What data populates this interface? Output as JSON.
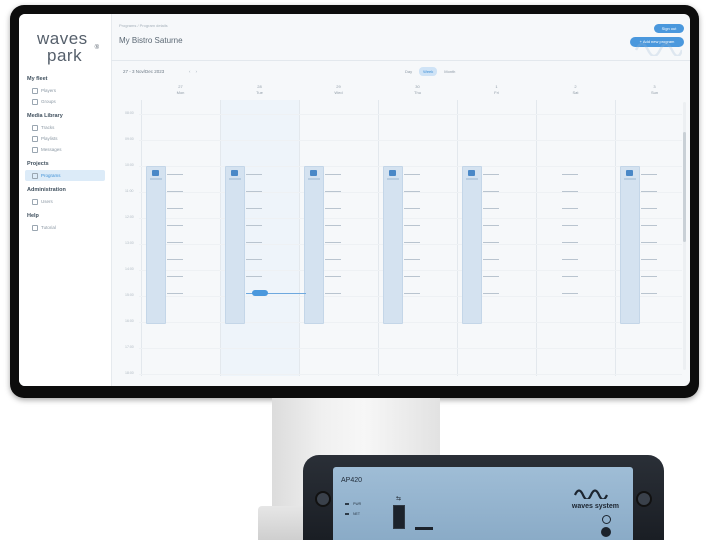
{
  "sidebar": {
    "logo_line1": "waves",
    "logo_line2": "park",
    "logo_reg": "®",
    "sections": [
      {
        "title": "My fleet",
        "items": [
          {
            "label": "Players",
            "icon": "player-icon"
          },
          {
            "label": "Groups",
            "icon": "group-icon"
          }
        ]
      },
      {
        "title": "Media Library",
        "items": [
          {
            "label": "Tracks",
            "icon": "track-icon"
          },
          {
            "label": "Playlists",
            "icon": "playlist-icon"
          },
          {
            "label": "Messages",
            "icon": "message-icon"
          }
        ]
      },
      {
        "title": "Projects",
        "items": [
          {
            "label": "Programs",
            "icon": "calendar-icon",
            "active": true
          }
        ]
      },
      {
        "title": "Administration",
        "items": [
          {
            "label": "Users",
            "icon": "user-icon"
          }
        ]
      },
      {
        "title": "Help",
        "items": [
          {
            "label": "Tutorial",
            "icon": "help-icon"
          }
        ]
      }
    ]
  },
  "header": {
    "breadcrumb": "Programs / Program details",
    "title": "My Bistro Saturne",
    "signout_label": "Sign out",
    "add_label": "+ Add new program"
  },
  "toolbar": {
    "date_range": "27 - 3 Nov/Dec 2023",
    "prev_icon": "chevron-left-icon",
    "next_icon": "chevron-right-icon",
    "views": [
      {
        "label": "Day"
      },
      {
        "label": "Week",
        "active": true
      },
      {
        "label": "Month"
      }
    ]
  },
  "calendar": {
    "days": [
      {
        "num": "27",
        "name": "Mon"
      },
      {
        "num": "28",
        "name": "Tue"
      },
      {
        "num": "29",
        "name": "Wed"
      },
      {
        "num": "30",
        "name": "Thu"
      },
      {
        "num": "1",
        "name": "Fri"
      },
      {
        "num": "2",
        "name": "Sat"
      },
      {
        "num": "3",
        "name": "Sun"
      }
    ],
    "times": [
      "08:00",
      "09:00",
      "10:00",
      "11:00",
      "12:00",
      "13:00",
      "14:00",
      "15:00",
      "16:00",
      "17:00",
      "18:00"
    ],
    "event_days": [
      0,
      1,
      2,
      3,
      4,
      6
    ],
    "highlight_day": 1,
    "now_label": "14:52"
  },
  "device": {
    "model": "AP420",
    "brand": "waves system",
    "led_labels": [
      "PWR",
      "NET"
    ]
  },
  "colors": {
    "accent": "#4a98dd",
    "event_fill": "#d4e2f0",
    "device_panel": "#9fbdd6",
    "bezel": "#0d0d0d"
  }
}
